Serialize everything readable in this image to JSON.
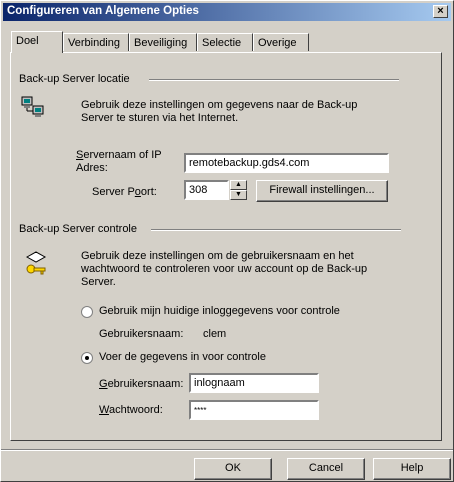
{
  "window": {
    "title": "Configureren van Algemene Opties",
    "close_glyph": "×"
  },
  "tabs": [
    "Doel",
    "Verbinding",
    "Beveiliging",
    "Selectie",
    "Overige"
  ],
  "server_location": {
    "group_label": "Back-up Server locatie",
    "description": "Gebruik deze instellingen om gegevens naar de Back-up Server te sturen via het Internet.",
    "servername_label_1": "Servernaam of IP",
    "servername_label_2": "Adres:",
    "servername_value": "remotebackup.gds4.com",
    "port_label": "Server Poort:",
    "port_value": "308",
    "firewall_button": "Firewall instellingen..."
  },
  "server_control": {
    "group_label": "Back-up Server controle",
    "description": "Gebruik deze instellingen om de gebruikersnaam en het wachtwoord te controleren voor uw account op de Back-up Server.",
    "option_current": "Gebruik mijn huidige inloggegevens voor controle",
    "current_user_label": "Gebruikersnaam:",
    "current_user_value": "clem",
    "option_enter": "Voer de gegevens in voor controle",
    "username_label": "Gebruikersnaam:",
    "username_value": "inlognaam",
    "password_label": "Wachtwoord:",
    "password_value": "****",
    "selected_option": "enter"
  },
  "footer": {
    "ok": "OK",
    "cancel": "Cancel",
    "help": "Help"
  }
}
